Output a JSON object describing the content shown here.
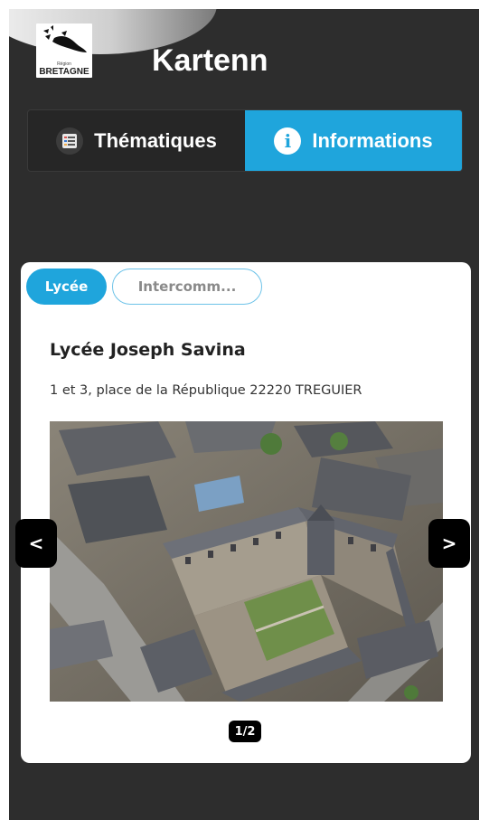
{
  "header": {
    "title": "Kartenn",
    "logo": {
      "sub_label": "Région",
      "label": "BRETAGNE"
    }
  },
  "tabs": [
    {
      "label": "Thématiques",
      "icon": "list-icon",
      "active": false
    },
    {
      "label": "Informations",
      "icon": "info-icon",
      "active": true
    }
  ],
  "card": {
    "chips": [
      {
        "label": "Lycée",
        "selected": true
      },
      {
        "label": "Intercomm...",
        "selected": false
      }
    ],
    "school_name": "Lycée Joseph Savina",
    "address": "1 et 3, place de la République 22220 TREGUIER",
    "carousel": {
      "prev_label": "<",
      "next_label": ">",
      "counter": "1/2"
    }
  },
  "colors": {
    "accent": "#1fa5dc",
    "background": "#2d2d2d",
    "card": "#ffffff"
  }
}
